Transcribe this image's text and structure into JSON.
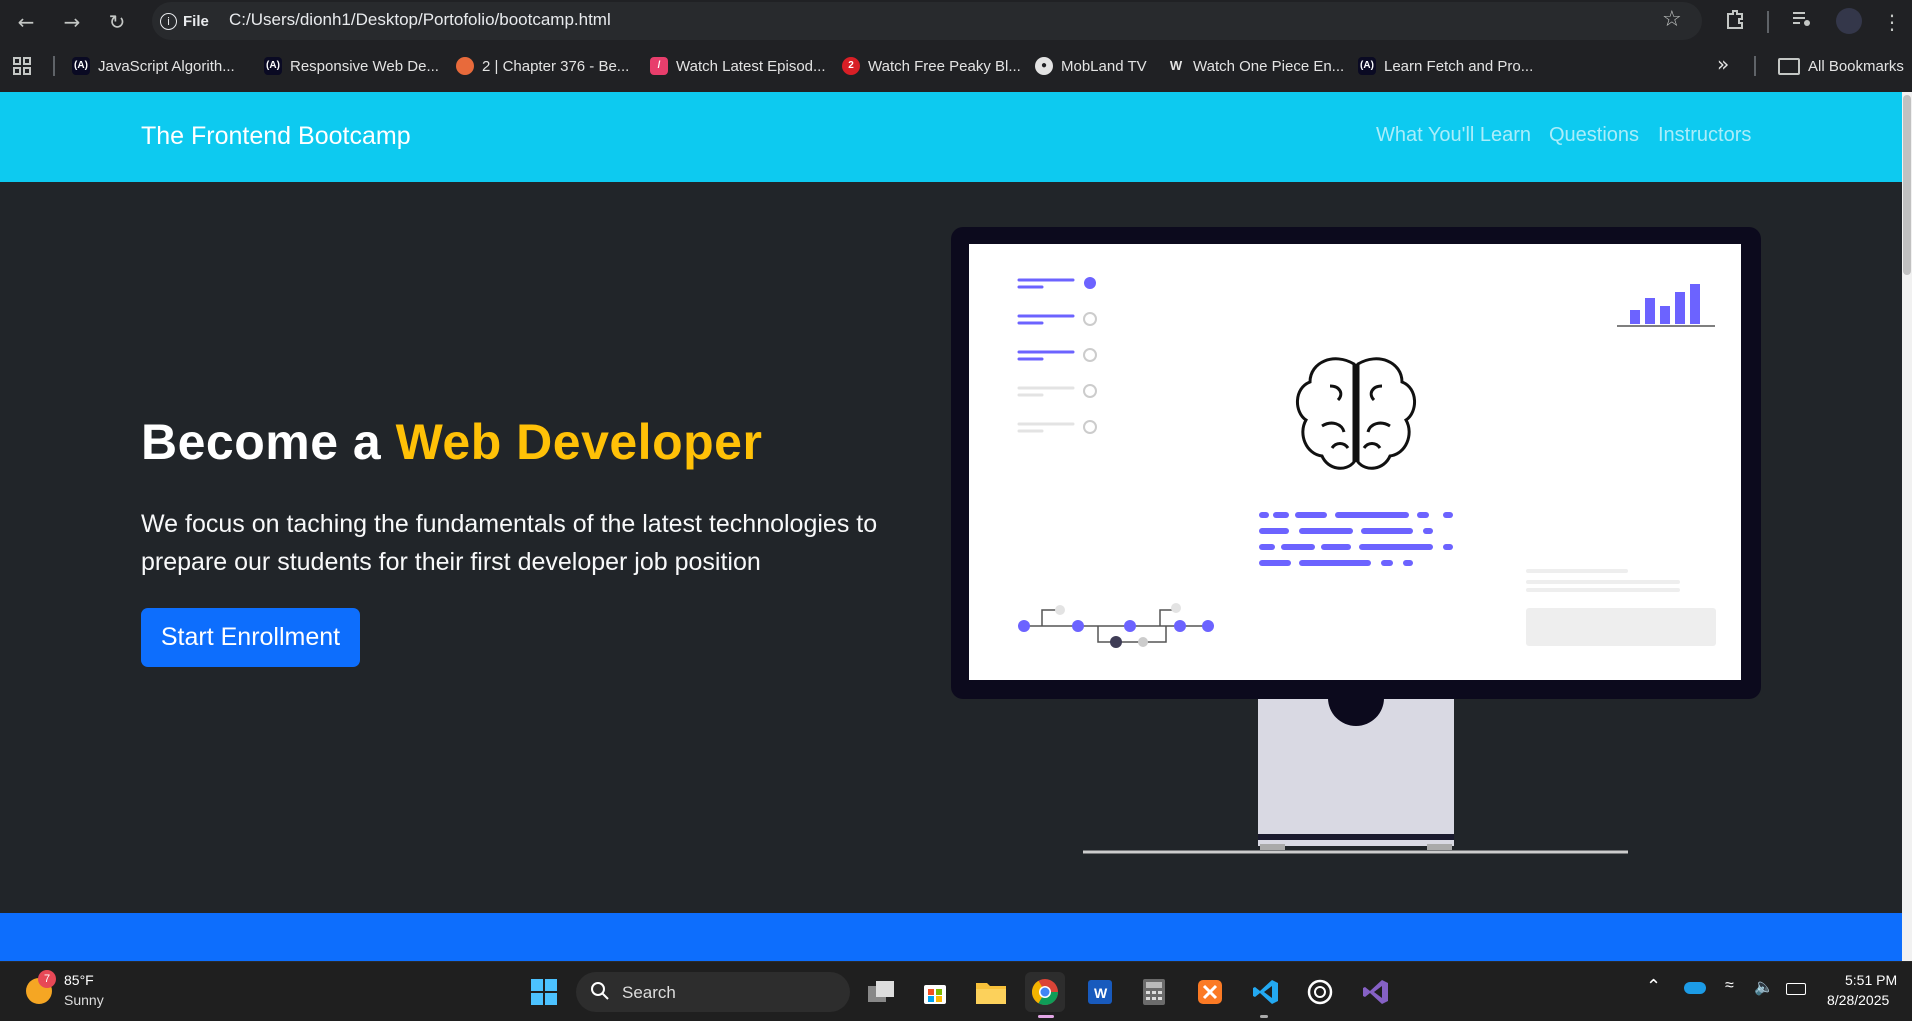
{
  "browser": {
    "file_label": "File",
    "url": "C:/Users/dionh1/Desktop/Portofolio/bootcamp.html",
    "bookmarks": [
      {
        "label": "JavaScript Algorith...",
        "icon": "fcc-icon"
      },
      {
        "label": "Responsive Web De...",
        "icon": "fcc-icon"
      },
      {
        "label": "2 | Chapter 376 - Be...",
        "icon": "cake-icon"
      },
      {
        "label": "Watch Latest Episod...",
        "icon": "brush-icon"
      },
      {
        "label": "Watch Free Peaky Bl...",
        "icon": "two-icon"
      },
      {
        "label": "MobLand TV",
        "icon": "globe-icon"
      },
      {
        "label": "Watch One Piece En...",
        "icon": "w-icon"
      },
      {
        "label": "Learn Fetch and Pro...",
        "icon": "fcc-icon"
      }
    ],
    "more": "»",
    "all_bookmarks": "All Bookmarks"
  },
  "site": {
    "brand": "The Frontend Bootcamp",
    "nav": [
      "What You'll Learn",
      "Questions",
      "Instructors"
    ],
    "hero": {
      "title_start": "Become a ",
      "title_highlight": "Web Developer",
      "text": "We focus on taching the fundamentals of the latest technologies to prepare our students for their first developer job position",
      "button": "Start Enrollment"
    },
    "colors": {
      "accent": "#0dcaf0",
      "highlight": "#ffc107",
      "primary": "#0d6efd",
      "bg": "#212529",
      "illustration": "#6c63ff"
    }
  },
  "taskbar": {
    "weather_badge": "7",
    "temperature": "85°F",
    "condition": "Sunny",
    "search": "Search",
    "time": "5:51 PM",
    "date": "8/28/2025"
  }
}
